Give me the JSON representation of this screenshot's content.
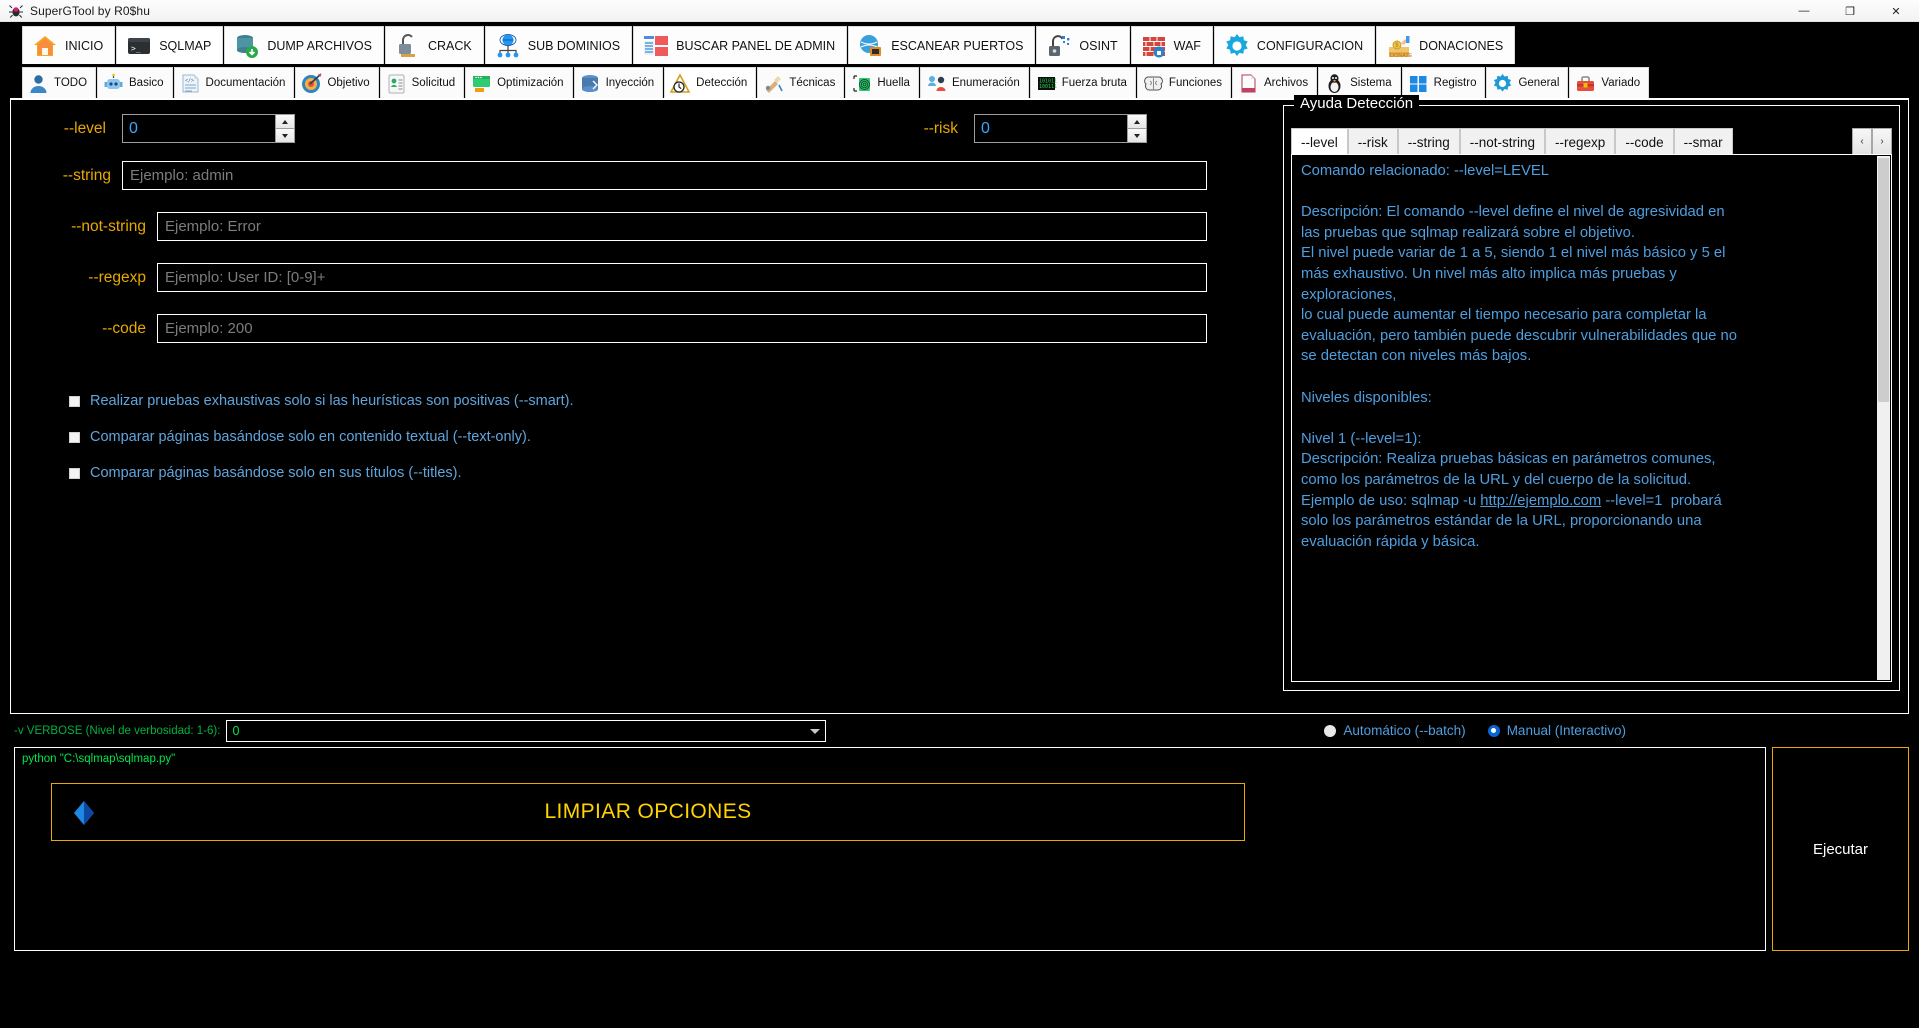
{
  "window": {
    "title": "SuperGTool by R0$hu",
    "app_icon": "bug-icon",
    "buttons": {
      "minimize": "—",
      "maximize": "❐",
      "close": "✕"
    }
  },
  "main_tabs": [
    {
      "label": "INICIO",
      "icon": "home-icon",
      "active": false
    },
    {
      "label": "SQLMAP",
      "icon": "terminal-icon",
      "active": true
    },
    {
      "label": "DUMP ARCHIVOS",
      "icon": "database-download-icon",
      "active": false
    },
    {
      "label": "CRACK",
      "icon": "unlock-icon",
      "active": false
    },
    {
      "label": "SUB DOMINIOS",
      "icon": "network-globe-icon",
      "active": false
    },
    {
      "label": "BUSCAR PANEL DE ADMIN",
      "icon": "admin-panel-icon",
      "active": false
    },
    {
      "label": "ESCANEAR PUERTOS",
      "icon": "port-scan-icon",
      "active": false
    },
    {
      "label": "OSINT",
      "icon": "padlock-open-icon",
      "active": false
    },
    {
      "label": "WAF",
      "icon": "firewall-icon",
      "active": false
    },
    {
      "label": "CONFIGURACION",
      "icon": "gear-icon",
      "active": false
    },
    {
      "label": "DONACIONES",
      "icon": "donate-icon",
      "active": false
    }
  ],
  "sub_tabs": [
    {
      "label": "TODO",
      "icon": "user-icon",
      "active": false
    },
    {
      "label": "Basico",
      "icon": "robot-icon",
      "active": false
    },
    {
      "label": "Documentación",
      "icon": "document-code-icon",
      "active": false
    },
    {
      "label": "Objetivo",
      "icon": "target-icon",
      "active": false
    },
    {
      "label": "Solicitud",
      "icon": "clipboard-person-icon",
      "active": false
    },
    {
      "label": "Optimización",
      "icon": "presentation-icon",
      "active": false
    },
    {
      "label": "Inyección",
      "icon": "database-icon",
      "active": false
    },
    {
      "label": "Detección",
      "icon": "detector-icon",
      "active": true
    },
    {
      "label": "Técnicas",
      "icon": "tools-icon",
      "active": false
    },
    {
      "label": "Huella",
      "icon": "fingerprint-icon",
      "active": false
    },
    {
      "label": "Enumeración",
      "icon": "enumerate-icon",
      "active": false
    },
    {
      "label": "Fuerza bruta",
      "icon": "binary-icon",
      "active": false
    },
    {
      "label": "Funciones",
      "icon": "brain-icon",
      "active": false
    },
    {
      "label": "Archivos",
      "icon": "file-icon",
      "active": false
    },
    {
      "label": "Sistema",
      "icon": "penguin-icon",
      "active": false
    },
    {
      "label": "Registro",
      "icon": "windows-icon",
      "active": false
    },
    {
      "label": "General",
      "icon": "settings-icon",
      "active": false
    },
    {
      "label": "Variado",
      "icon": "toolbox-icon",
      "active": false
    }
  ],
  "form": {
    "level": {
      "label": "--level",
      "value": "0"
    },
    "risk": {
      "label": "--risk",
      "value": "0"
    },
    "string": {
      "label": "--string",
      "value": "",
      "placeholder": "Ejemplo: admin"
    },
    "not_string": {
      "label": "--not-string",
      "value": "",
      "placeholder": "Ejemplo: Error"
    },
    "regexp": {
      "label": "--regexp",
      "value": "",
      "placeholder": "Ejemplo: User ID: [0-9]+"
    },
    "code": {
      "label": "--code",
      "value": "",
      "placeholder": "Ejemplo: 200"
    },
    "checkboxes": [
      {
        "label": "Realizar pruebas exhaustivas solo si las heurísticas son positivas (--smart).",
        "checked": false
      },
      {
        "label": "Comparar páginas basándose solo en contenido textual (--text-only).",
        "checked": false
      },
      {
        "label": "Comparar páginas basándose solo en sus títulos (--titles).",
        "checked": false
      }
    ],
    "clear_button": {
      "label": "LIMPIAR OPCIONES",
      "icon": "eraser-icon",
      "accent": "#e8a800"
    }
  },
  "help": {
    "legend": "Ayuda Detección",
    "tabs": [
      {
        "label": "--level",
        "active": true
      },
      {
        "label": "--risk",
        "active": false
      },
      {
        "label": "--string",
        "active": false
      },
      {
        "label": "--not-string",
        "active": false
      },
      {
        "label": "--regexp",
        "active": false
      },
      {
        "label": "--code",
        "active": false
      },
      {
        "label": "--smar",
        "active": false
      }
    ],
    "nav": {
      "prev": "‹",
      "next": "›"
    },
    "body_intro": "Comando relacionado: --level=LEVEL\n\nDescripción: El comando --level define el nivel de agresividad en\nlas pruebas que sqlmap realizará sobre el objetivo.\nEl nivel puede variar de 1 a 5, siendo 1 el nivel más básico y 5 el\nmás exhaustivo. Un nivel más alto implica más pruebas y\nexploraciones,\nlo cual puede aumentar el tiempo necesario para completar la\nevaluación, pero también puede descubrir vulnerabilidades que no\nse detectan con niveles más bajos.\n\nNiveles disponibles:\n\nNivel 1 (--level=1):\nDescripción: Realiza pruebas básicas en parámetros comunes,\ncomo los parámetros de la URL y del cuerpo de la solicitud.\nEjemplo de uso: sqlmap -u ",
    "body_link": "http://ejemplo.com",
    "body_outro": " --level=1  probará\nsolo los parámetros estándar de la URL, proporcionando una\nevaluación rápida y básica."
  },
  "bottom": {
    "verbose_label": "-v VERBOSE (Nivel de verbosidad: 1-6):",
    "verbose_value": "0",
    "mode_options": [
      {
        "label": "Automático (--batch)",
        "selected": false
      },
      {
        "label": "Manual (Interactivo)",
        "selected": true
      }
    ],
    "console_text": "python \"C:\\sqlmap\\sqlmap.py\"",
    "execute_label": "Ejecutar"
  }
}
